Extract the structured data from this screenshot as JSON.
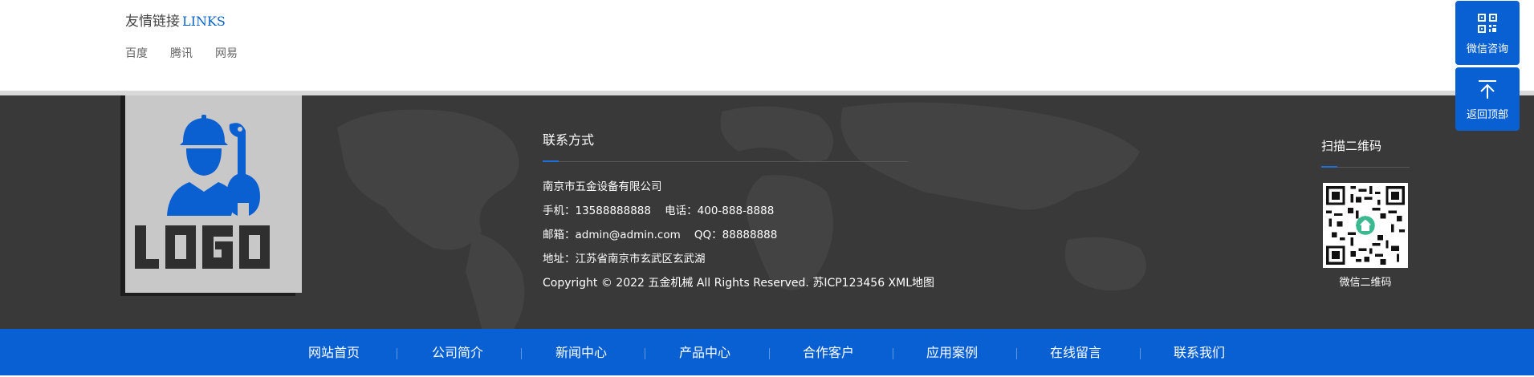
{
  "links": {
    "title_cn": "友情链接",
    "title_en": "LINKS",
    "items": [
      "百度",
      "腾讯",
      "网易"
    ]
  },
  "logo": {
    "text": "LOGO"
  },
  "contact": {
    "title": "联系方式",
    "company": "南京市五金设备有限公司",
    "phone_line": "手机：13588888888    电话：400-888-8888",
    "email_line": "邮箱：admin@admin.com    QQ：88888888",
    "address_line": "地址：江苏省南京市玄武区玄武湖",
    "copyright_line": "Copyright © 2022 五金机械 All Rights Reserved. 苏ICP123456 XML地图"
  },
  "qr": {
    "title": "扫描二维码",
    "caption": "微信二维码"
  },
  "nav": {
    "items": [
      "网站首页",
      "公司简介",
      "新闻中心",
      "产品中心",
      "合作客户",
      "应用案例",
      "在线留言",
      "联系我们"
    ]
  },
  "float": {
    "wechat_label": "微信咨询",
    "top_label": "返回顶部"
  },
  "colors": {
    "accent": "#0860d3",
    "footer_bg": "#393939",
    "logo_icon": "#0a5fd1"
  }
}
